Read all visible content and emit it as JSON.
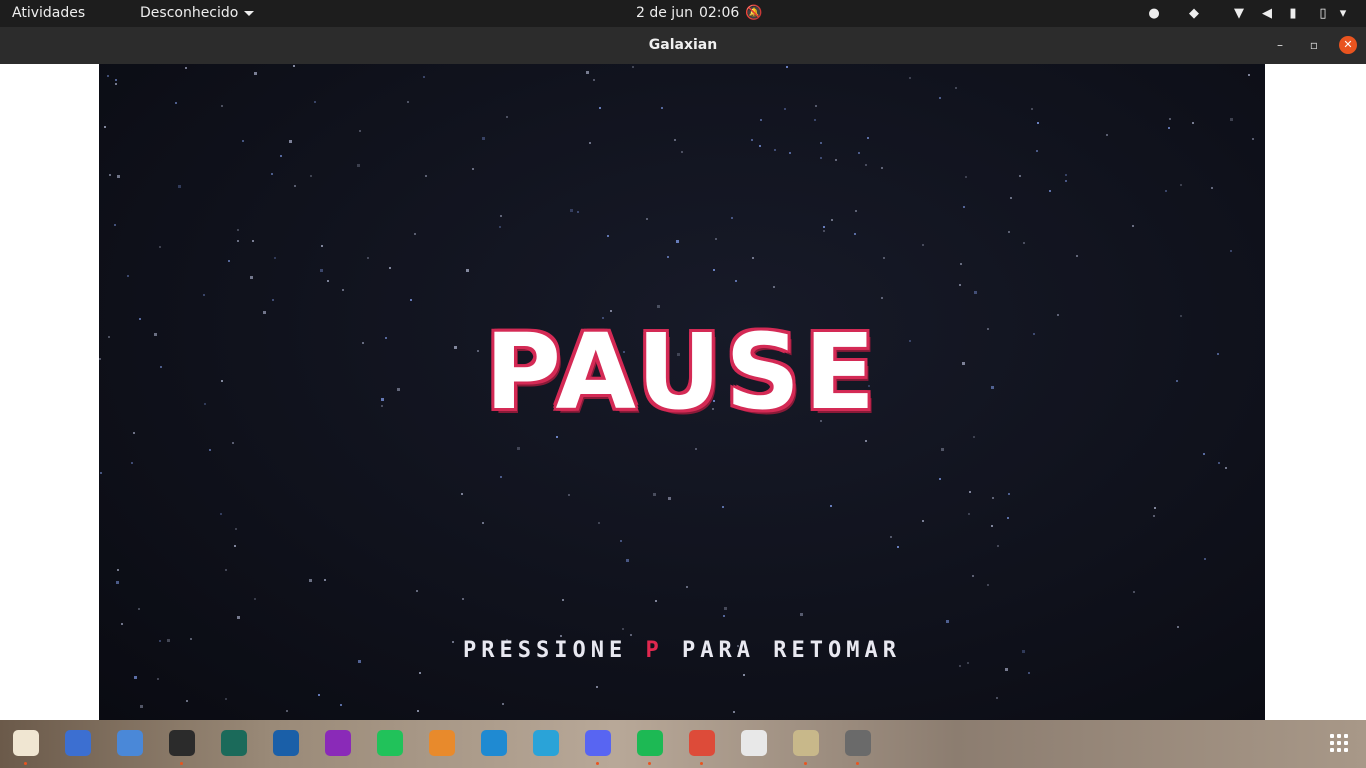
{
  "topbar": {
    "activities": "Atividades",
    "app_menu": "Desconhecido",
    "date": "2 de jun",
    "time": "02:06"
  },
  "window": {
    "title": "Galaxian"
  },
  "game": {
    "pause_title": "PAUSE",
    "resume_pre": "PRESSIONE",
    "resume_key": "P",
    "resume_post": "PARA RETOMAR"
  },
  "colors": {
    "accent": "#d42a55",
    "key": "#e0284f",
    "background": "#0f111b"
  },
  "dock": {
    "items": [
      {
        "icon": "files-icon"
      },
      {
        "icon": "screenshot-icon"
      },
      {
        "icon": "text-editor-icon"
      },
      {
        "icon": "terminal-icon"
      },
      {
        "icon": "gitkraken-icon"
      },
      {
        "icon": "virtualbox-icon"
      },
      {
        "icon": "phpstorm-icon"
      },
      {
        "icon": "pycharm-icon"
      },
      {
        "icon": "app-cube-icon"
      },
      {
        "icon": "vscode-icon"
      },
      {
        "icon": "telegram-icon"
      },
      {
        "icon": "discord-icon"
      },
      {
        "icon": "spotify-icon"
      },
      {
        "icon": "chrome-icon"
      },
      {
        "icon": "document-viewer-icon"
      },
      {
        "icon": "archive-manager-icon"
      },
      {
        "icon": "game-window-icon"
      }
    ]
  }
}
